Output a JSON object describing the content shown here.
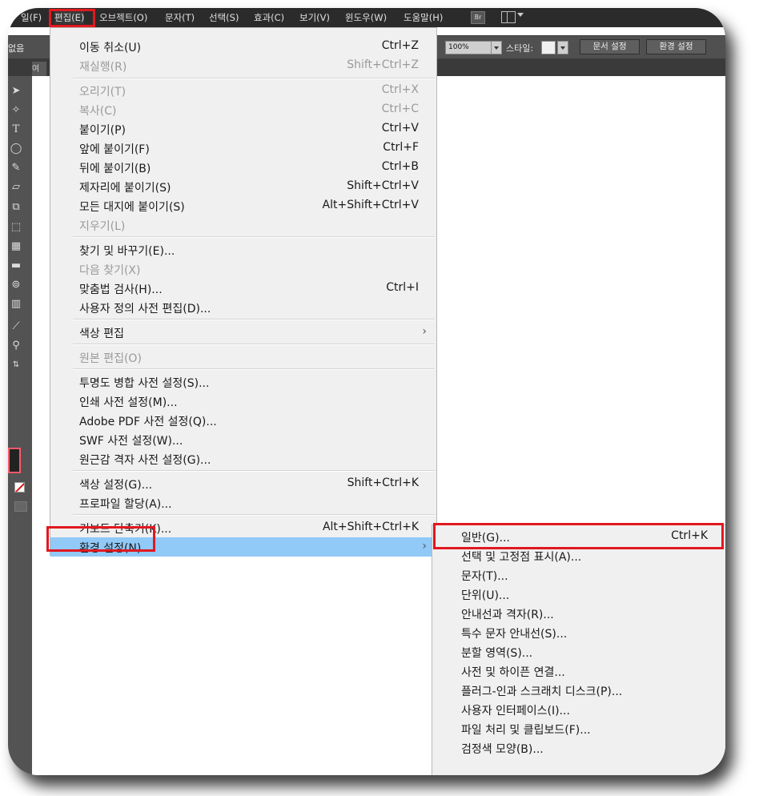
{
  "menubar": {
    "items": [
      {
        "label": "일(F)"
      },
      {
        "label": "편집(E)"
      },
      {
        "label": "오브젝트(O)"
      },
      {
        "label": "문자(T)"
      },
      {
        "label": "선택(S)"
      },
      {
        "label": "효과(C)"
      },
      {
        "label": "보기(V)"
      },
      {
        "label": "윈도우(W)"
      },
      {
        "label": "도움말(H)"
      }
    ],
    "bridge_label": "Br"
  },
  "control_bar": {
    "left_text": "없음",
    "zoom_value": "100%",
    "style_label": "스타일:",
    "document_setup_button": "문서 설정",
    "preferences_button": "환경 설정"
  },
  "tab_row": {
    "tab_label": "여"
  },
  "edit_menu": {
    "groups": [
      [
        {
          "label": "이동 취소(U)",
          "shortcut": "Ctrl+Z",
          "enabled": true
        },
        {
          "label": "재실행(R)",
          "shortcut": "Shift+Ctrl+Z",
          "enabled": false
        }
      ],
      [
        {
          "label": "오리기(T)",
          "shortcut": "Ctrl+X",
          "enabled": false
        },
        {
          "label": "복사(C)",
          "shortcut": "Ctrl+C",
          "enabled": false
        },
        {
          "label": "붙이기(P)",
          "shortcut": "Ctrl+V",
          "enabled": true
        },
        {
          "label": "앞에 붙이기(F)",
          "shortcut": "Ctrl+F",
          "enabled": true
        },
        {
          "label": "뒤에 붙이기(B)",
          "shortcut": "Ctrl+B",
          "enabled": true
        },
        {
          "label": "제자리에 붙이기(S)",
          "shortcut": "Shift+Ctrl+V",
          "enabled": true
        },
        {
          "label": "모든 대지에 붙이기(S)",
          "shortcut": "Alt+Shift+Ctrl+V",
          "enabled": true
        },
        {
          "label": "지우기(L)",
          "shortcut": "",
          "enabled": false
        }
      ],
      [
        {
          "label": "찾기 및 바꾸기(E)...",
          "shortcut": "",
          "enabled": true
        },
        {
          "label": "다음 찾기(X)",
          "shortcut": "",
          "enabled": false
        },
        {
          "label": "맞춤법 검사(H)...",
          "shortcut": "Ctrl+I",
          "enabled": true
        },
        {
          "label": "사용자 정의 사전 편집(D)...",
          "shortcut": "",
          "enabled": true
        }
      ],
      [
        {
          "label": "색상 편집",
          "shortcut": "",
          "enabled": true,
          "submenu": true
        }
      ],
      [
        {
          "label": "원본 편집(O)",
          "shortcut": "",
          "enabled": false
        }
      ],
      [
        {
          "label": "투명도 병합 사전 설정(S)...",
          "shortcut": "",
          "enabled": true
        },
        {
          "label": "인쇄 사전 설정(M)...",
          "shortcut": "",
          "enabled": true
        },
        {
          "label": "Adobe PDF 사전 설정(Q)...",
          "shortcut": "",
          "enabled": true
        },
        {
          "label": "SWF 사전 설정(W)...",
          "shortcut": "",
          "enabled": true
        },
        {
          "label": "원근감 격자 사전 설정(G)...",
          "shortcut": "",
          "enabled": true
        }
      ],
      [
        {
          "label": "색상 설정(G)...",
          "shortcut": "Shift+Ctrl+K",
          "enabled": true
        },
        {
          "label": "프로파일 할당(A)...",
          "shortcut": "",
          "enabled": true
        }
      ],
      [
        {
          "label": "키보드 단축키(K)...",
          "shortcut": "Alt+Shift+Ctrl+K",
          "enabled": true
        },
        {
          "label": "환경 설정(N)",
          "shortcut": "",
          "enabled": true,
          "submenu": true,
          "highlighted": true
        }
      ]
    ]
  },
  "preferences_submenu": {
    "items": [
      {
        "label": "일반(G)...",
        "shortcut": "Ctrl+K"
      },
      {
        "label": "선택 및 고정점 표시(A)...",
        "shortcut": ""
      },
      {
        "label": "문자(T)...",
        "shortcut": ""
      },
      {
        "label": "단위(U)...",
        "shortcut": ""
      },
      {
        "label": "안내선과 격자(R)...",
        "shortcut": ""
      },
      {
        "label": "특수 문자 안내선(S)...",
        "shortcut": ""
      },
      {
        "label": "분할 영역(S)...",
        "shortcut": ""
      },
      {
        "label": "사전 및 하이픈 연결...",
        "shortcut": ""
      },
      {
        "label": "플러그-인과 스크래치 디스크(P)...",
        "shortcut": ""
      },
      {
        "label": "사용자 인터페이스(I)...",
        "shortcut": ""
      },
      {
        "label": "파일 처리 및 클립보드(F)...",
        "shortcut": ""
      },
      {
        "label": "검정색 모양(B)...",
        "shortcut": ""
      }
    ]
  },
  "colors": {
    "highlight_border": "#e2181f",
    "menu_selection": "#91c9f7",
    "menu_background": "#f0f0f0",
    "app_dark": "#2b2b2b",
    "fill_indicator": "#ff5a6a"
  },
  "tool_icons": [
    "selection-icon",
    "direct-selection-icon",
    "type-icon",
    "ellipse-icon",
    "pen-icon",
    "eraser-icon",
    "scale-icon",
    "free-transform-icon",
    "graph-icon",
    "gradient-icon",
    "shape-builder-icon",
    "column-graph-icon",
    "eyedropper-icon",
    "zoom-icon",
    "swap-icon"
  ]
}
